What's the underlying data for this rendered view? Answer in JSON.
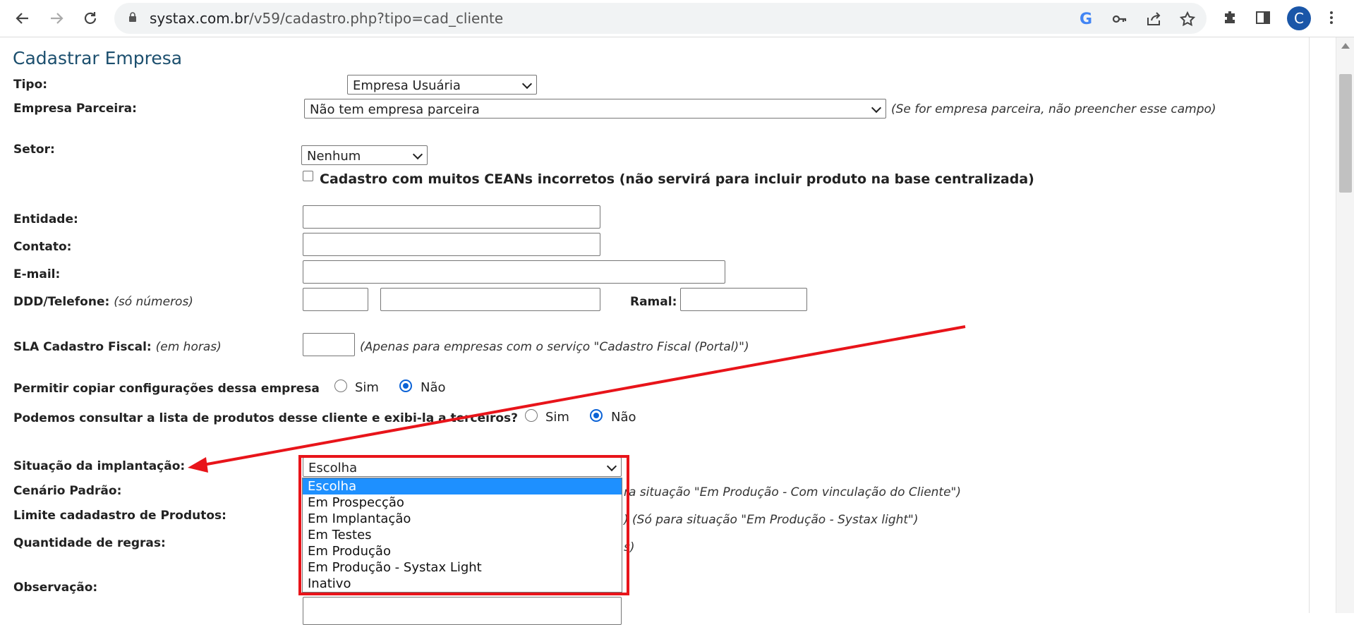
{
  "browser": {
    "url_host": "systax.com.br",
    "url_path": "/v59/cadastro.php?tipo=cad_cliente",
    "profile_initial": "C",
    "icons": [
      "back-icon",
      "forward-icon",
      "reload-icon",
      "lock-icon",
      "google-icon",
      "key-icon",
      "share-icon",
      "star-icon",
      "extensions-icon",
      "side-panel-icon",
      "more-icon"
    ]
  },
  "form": {
    "title": "Cadastrar Empresa",
    "tipo_label": "Tipo:",
    "tipo_value": "Empresa Usuária",
    "parceira_label": "Empresa Parceira:",
    "parceira_value": "Não tem empresa parceira",
    "parceira_note": "(Se for empresa parceira, não preencher esse campo)",
    "setor_label": "Setor:",
    "setor_value": "Nenhum",
    "ceans_label": "Cadastro com muitos CEANs incorretos (não servirá para incluir produto na base centralizada)",
    "ceans_checked": false,
    "entidade_label": "Entidade:",
    "contato_label": "Contato:",
    "email_label": "E-mail:",
    "telefone_label": "DDD/Telefone:",
    "telefone_hint": "(só números)",
    "ramal_label": "Ramal:",
    "sla_label": "SLA Cadastro Fiscal:",
    "sla_hint": "(em horas)",
    "sla_note": "(Apenas para empresas com o serviço \"Cadastro Fiscal (Portal)\")",
    "copiar_label": "Permitir copiar configurações dessa empresa",
    "consultar_label": "Podemos consultar a lista de produtos desse cliente e exibi-la a terceiros?",
    "sim_label": "Sim",
    "nao_label": "Não",
    "copiar_selected": "Não",
    "consultar_selected": "Não",
    "situacao_label": "Situação da implantação:",
    "situacao_value": "Escolha",
    "cenario_label": "Cenário Padrão:",
    "cenario_note": "ra situação \"Em Produção - Com vinculação do Cliente\")",
    "limite_label": "Limite cadadastro de Produtos:",
    "limite_note": ") (Só para situação \"Em Produção - Systax light\")",
    "regras_label": "Quantidade de regras:",
    "regras_note": "s)",
    "observacao_label": "Observação:"
  },
  "situacao_options": [
    {
      "label": "Escolha",
      "selected": true
    },
    {
      "label": "Em Prospecção",
      "selected": false
    },
    {
      "label": "Em Implantação",
      "selected": false
    },
    {
      "label": "Em Testes",
      "selected": false
    },
    {
      "label": "Em Produção",
      "selected": false
    },
    {
      "label": "Em Produção - Systax Light",
      "selected": false
    },
    {
      "label": "Inativo",
      "selected": false
    }
  ],
  "colors": {
    "annotation_red": "#e8141a",
    "selection_blue": "#1e90ff",
    "radio_blue": "#0b62d6",
    "title_color": "#1c4f6e"
  }
}
